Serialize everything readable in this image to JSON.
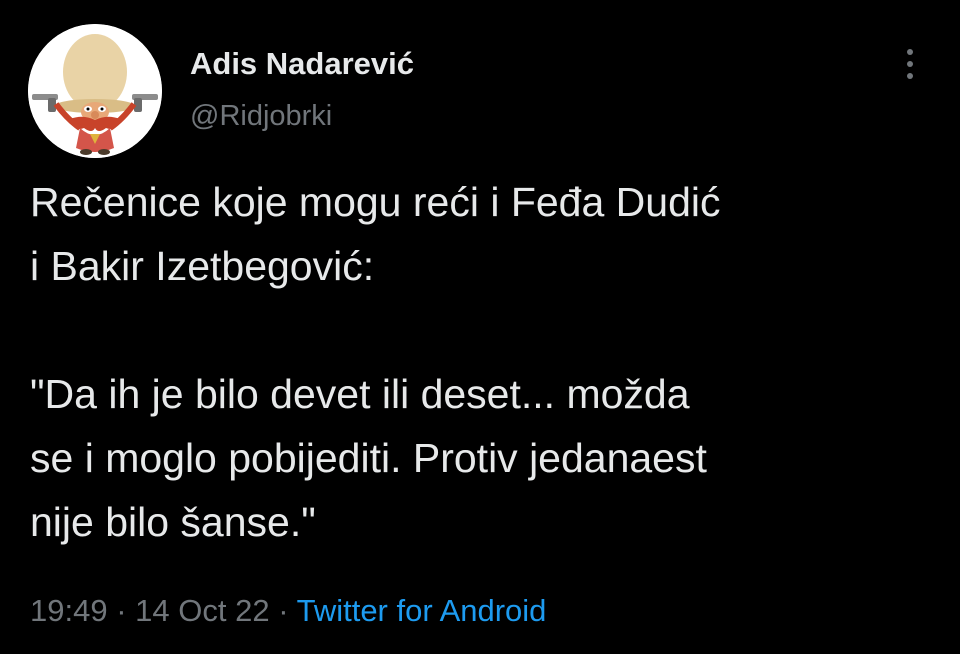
{
  "author": {
    "display_name": "Adis Nadarević",
    "handle": "@Ridjobrki",
    "avatar_icon": "cartoon-prospector-with-revolvers"
  },
  "more_icon": "vertical-ellipsis-icon",
  "tweet": {
    "lines": [
      "Rečenice koje mogu reći i Feđa Dudić",
      "i Bakir Izetbegović:",
      "\"Da ih je bilo devet ili deset... možda",
      "se i moglo pobijediti. Protiv jedanaest",
      "nije bilo šanse.\""
    ]
  },
  "meta": {
    "time": "19:49",
    "separator": "·",
    "date": "14 Oct 22",
    "source": "Twitter for Android"
  },
  "colors": {
    "background": "#000000",
    "text": "#e7e9ea",
    "secondary": "#71767b",
    "link": "#1d9bf0"
  }
}
